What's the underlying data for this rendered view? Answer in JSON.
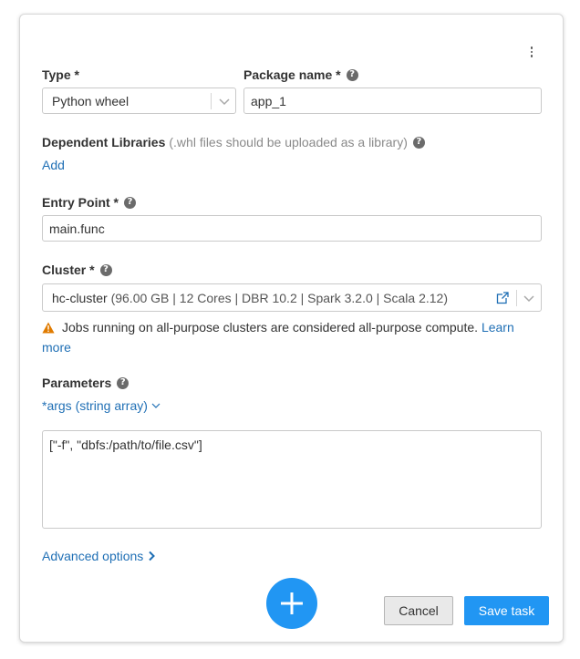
{
  "type": {
    "label": "Type *",
    "value": "Python wheel"
  },
  "package_name": {
    "label": "Package name *",
    "value": "app_1"
  },
  "dependent_libraries": {
    "label": "Dependent Libraries",
    "hint": "(.whl files should be uploaded as a library)",
    "add_link": "Add"
  },
  "entry_point": {
    "label": "Entry Point *",
    "value": "main.func"
  },
  "cluster": {
    "label": "Cluster *",
    "name": "hc-cluster",
    "details": " (96.00 GB | 12 Cores | DBR 10.2 | Spark 3.2.0 | Scala 2.12)",
    "warning": "Jobs running on all-purpose clusters are considered all-purpose compute.",
    "warning_link": "Learn more"
  },
  "parameters": {
    "label": "Parameters",
    "mode": "*args (string array)",
    "value": "[\"-f\", \"dbfs:/path/to/file.csv\"]"
  },
  "advanced_options": "Advanced options",
  "buttons": {
    "cancel": "Cancel",
    "save": "Save task"
  },
  "colors": {
    "accent": "#2196f3",
    "link": "#1f6fb5",
    "warning": "#e07b00"
  },
  "icons": {
    "menu": "more-vertical-icon",
    "help": "question-circle-icon",
    "chevron": "chevron-down-icon",
    "external": "external-link-icon",
    "warning": "warning-triangle-icon",
    "add": "plus-icon",
    "chevron_right": "chevron-right-icon"
  }
}
